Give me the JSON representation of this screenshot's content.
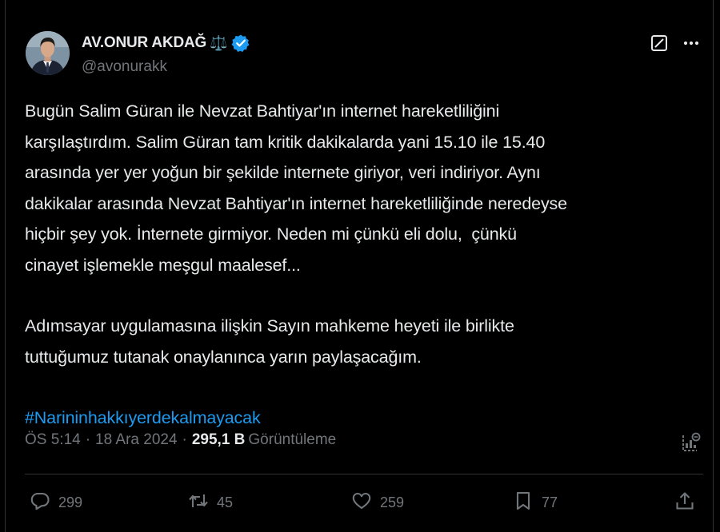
{
  "author": {
    "display_name": "AV.ONUR AKDAĞ",
    "name_emoji": "⚖️",
    "handle": "@avonurakk",
    "verified": true
  },
  "tweet": {
    "paragraph1_lines": [
      "Bugün Salim Güran ile Nevzat Bahtiyar'ın internet hareketliliğini",
      "karşılaştırdım. Salim Güran tam kritik dakikalarda yani 15.10 ile 15.40",
      "arasında yer yer yoğun bir şekilde internete giriyor, veri indiriyor. Aynı",
      "dakikalar arasında Nevzat Bahtiyar'ın internet hareketliliğinde neredeyse",
      "hiçbir şey yok. İnternete girmiyor. Neden mi çünkü eli dolu,  çünkü",
      "cinayet işlemekle meşgul maalesef..."
    ],
    "paragraph2_lines": [
      "Adımsayar uygulamasına ilişkin Sayın mahkeme heyeti ile birlikte",
      "tuttuğumuz tutanak onaylanınca yarın paylaşacağım."
    ],
    "hashtag": "#Narininhakkıyerdekalmayacak"
  },
  "meta": {
    "time": "ÖS 5:14",
    "separator": "·",
    "date": "18 Ara 2024",
    "views_count": "295,1 B",
    "views_label": "Görüntüleme"
  },
  "actions": {
    "replies": "299",
    "reposts": "45",
    "likes": "259",
    "bookmarks": "77"
  },
  "colors": {
    "background": "#000000",
    "text": "#e7e9ea",
    "secondary": "#71767b",
    "accent": "#1d9bf0",
    "divider": "#2f3336"
  },
  "icons": {
    "grok": "grok-icon",
    "more": "more-icon",
    "verified": "verified-badge-icon",
    "analytics": "analytics-icon",
    "reply": "reply-icon",
    "repost": "repost-icon",
    "like": "like-icon",
    "bookmark": "bookmark-icon",
    "share": "share-icon"
  }
}
